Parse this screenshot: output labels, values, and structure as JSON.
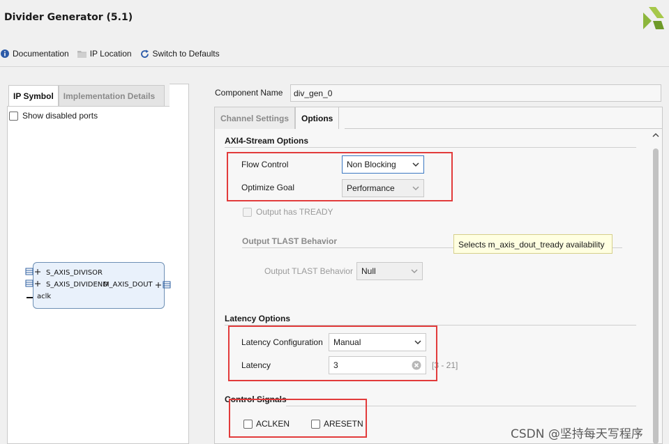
{
  "app": {
    "title": "Divider Generator (5.1)"
  },
  "toolbar": {
    "documentation": "Documentation",
    "ip_location": "IP Location",
    "switch_defaults": "Switch to Defaults"
  },
  "left": {
    "tabs": [
      "IP Symbol",
      "Implementation Details"
    ],
    "show_disabled_ports": "Show disabled ports",
    "ports": {
      "s_axis_divisor": "S_AXIS_DIVISOR",
      "s_axis_dividend": "S_AXIS_DIVIDEND",
      "m_axis_dout": "M_AXIS_DOUT",
      "aclk": "aclk"
    }
  },
  "component": {
    "label": "Component Name",
    "value": "div_gen_0"
  },
  "right_tabs": [
    "Channel Settings",
    "Options"
  ],
  "axi": {
    "title": "AXI4-Stream Options",
    "flow_control_label": "Flow Control",
    "flow_control_value": "Non Blocking",
    "optimize_goal_label": "Optimize Goal",
    "optimize_goal_value": "Performance",
    "output_tready": "Output has TREADY",
    "tlast_title": "Output TLAST Behavior",
    "tlast_label": "Output TLAST Behavior",
    "tlast_value": "Null"
  },
  "tooltip": "Selects m_axis_dout_tready availability",
  "latency": {
    "title": "Latency Options",
    "config_label": "Latency Configuration",
    "config_value": "Manual",
    "latency_label": "Latency",
    "latency_value": "3",
    "range": "[3 - 21]"
  },
  "control": {
    "title": "Control Signals",
    "aclken": "ACLKEN",
    "aresetn": "ARESETN"
  },
  "watermark": "CSDN @坚持每天写程序",
  "colors": {
    "highlight_box": "#e23b3b",
    "focus_border": "#3a77c2",
    "logo_green": "#8cb63c"
  }
}
